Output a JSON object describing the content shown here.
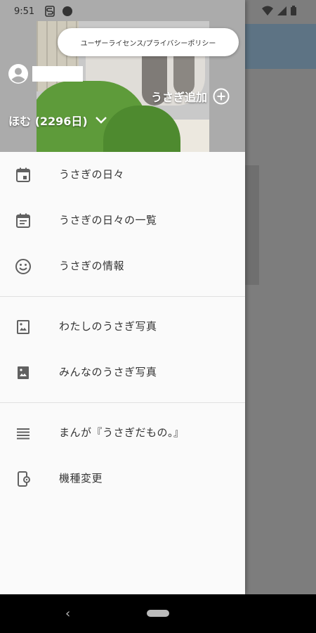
{
  "status_bar": {
    "time": "9:51",
    "icons": [
      "s-icon",
      "facebook-icon",
      "wifi-icon",
      "signal-icon",
      "battery-icon"
    ]
  },
  "header": {
    "policy_button_label": "ユーザーライセンス/プライバシーポリシー",
    "add_rabbit_label": "うさぎ追加",
    "rabbit_selector_label": "ほむ (2296日)"
  },
  "menu": {
    "group1": [
      {
        "label": "うさぎの日々",
        "icon": "calendar-icon"
      },
      {
        "label": "うさぎの日々の一覧",
        "icon": "calendar-list-icon"
      },
      {
        "label": "うさぎの情報",
        "icon": "smiley-icon"
      }
    ],
    "group2": [
      {
        "label": "わたしのうさぎ写真",
        "icon": "photo-outline-icon"
      },
      {
        "label": "みんなのうさぎ写真",
        "icon": "photo-icon"
      }
    ],
    "group3": [
      {
        "label": "まんが『うさぎだもの。』",
        "icon": "lines-icon"
      },
      {
        "label": "機種変更",
        "icon": "device-change-icon"
      }
    ]
  },
  "colors": {
    "drawer_bg": "#fafafa",
    "header_gray": "#ababab",
    "scrim_bg": "#7d7d7d",
    "text_primary": "#333333",
    "icon_gray": "#616161"
  }
}
